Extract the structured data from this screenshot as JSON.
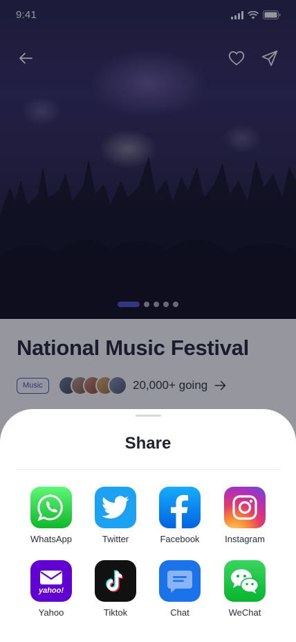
{
  "status_bar": {
    "time": "9:41"
  },
  "event": {
    "title": "National Music Festival",
    "tag": "Music",
    "going": "20,000+ going"
  },
  "pager": {
    "count": 5,
    "active_index": 0
  },
  "share_sheet": {
    "title": "Share",
    "apps": [
      {
        "label": "WhatsApp",
        "icon": "whatsapp-icon",
        "color": "#25d366"
      },
      {
        "label": "Twitter",
        "icon": "twitter-icon",
        "color": "#1da1f2"
      },
      {
        "label": "Facebook",
        "icon": "facebook-icon",
        "color": "#1877f2"
      },
      {
        "label": "Instagram",
        "icon": "instagram-icon",
        "color": "#e1306c"
      },
      {
        "label": "Yahoo",
        "icon": "yahoo-icon",
        "color": "#6001d2"
      },
      {
        "label": "Tiktok",
        "icon": "tiktok-icon",
        "color": "#000000"
      },
      {
        "label": "Chat",
        "icon": "chat-icon",
        "color": "#1a73e8"
      },
      {
        "label": "WeChat",
        "icon": "wechat-icon",
        "color": "#09b83e"
      }
    ]
  },
  "colors": {
    "accent": "#4b4fc8",
    "text": "#1f2130"
  }
}
